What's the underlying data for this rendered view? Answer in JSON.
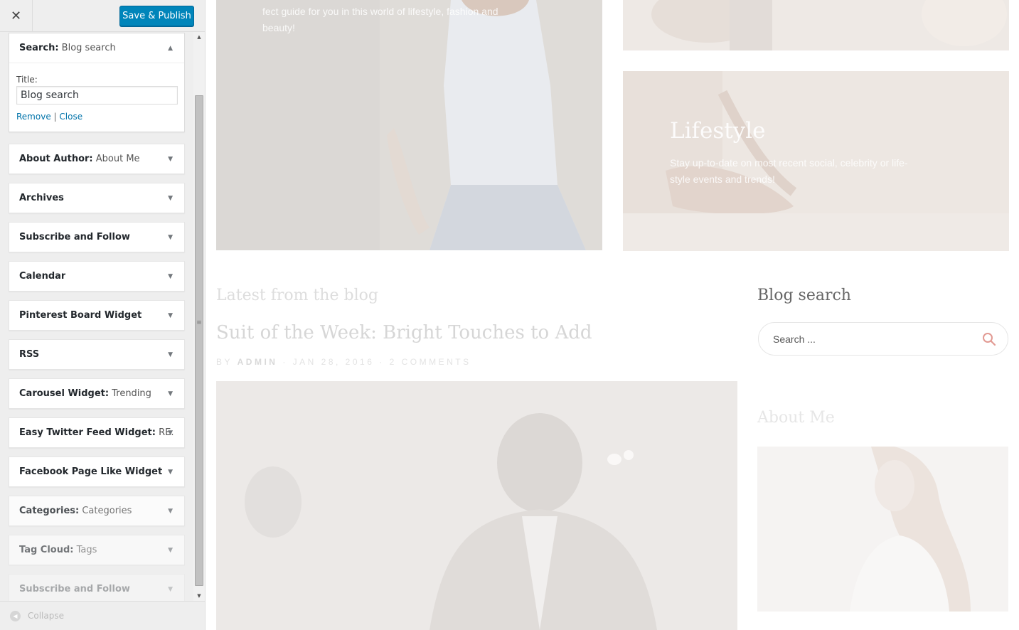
{
  "header": {
    "close_icon": "close-icon",
    "publish_label": "Save & Publish",
    "accent_color": "#0085ba"
  },
  "open_widget": {
    "name": "Search:",
    "subtitle": "Blog search",
    "field_label": "Title:",
    "field_value": "Blog search",
    "remove_label": "Remove",
    "separator": "|",
    "close_label": "Close"
  },
  "widgets": [
    {
      "name": "About Author:",
      "subtitle": "About Me"
    },
    {
      "name": "Archives",
      "subtitle": ""
    },
    {
      "name": "Subscribe and Follow",
      "subtitle": ""
    },
    {
      "name": "Calendar",
      "subtitle": ""
    },
    {
      "name": "Pinterest Board Widget",
      "subtitle": ""
    },
    {
      "name": "RSS",
      "subtitle": ""
    },
    {
      "name": "Carousel Widget:",
      "subtitle": "Trending"
    },
    {
      "name": "Easy Twitter Feed Widget:",
      "subtitle": "RE..."
    },
    {
      "name": "Facebook Page Like Widget",
      "subtitle": ""
    },
    {
      "name": "Categories:",
      "subtitle": "Categories"
    },
    {
      "name": "Tag Cloud:",
      "subtitle": "Tags"
    },
    {
      "name": "Subscribe and Follow",
      "subtitle": ""
    }
  ],
  "collapse_label": "Collapse",
  "preview": {
    "hero_left_text": "fect guide for you in this world of lifestyle, fashion and beauty!",
    "lifestyle_title": "Lifestyle",
    "lifestyle_text": "Stay up-to-date on most recent social, celebrity or life-style events and trends!",
    "latest_heading": "Latest from the blog",
    "post_title": "Suit of the Week: Bright Touches to Add",
    "post_meta_by": "BY",
    "post_meta_author": "ADMIN",
    "post_meta_dot1": "·",
    "post_meta_date": "JAN 28, 2016",
    "post_meta_dot2": "·",
    "post_meta_comments": "2 COMMENTS",
    "search_widget_title": "Blog search",
    "search_placeholder": "Search ...",
    "search_icon_color": "#e29a93",
    "about_title": "About Me"
  }
}
